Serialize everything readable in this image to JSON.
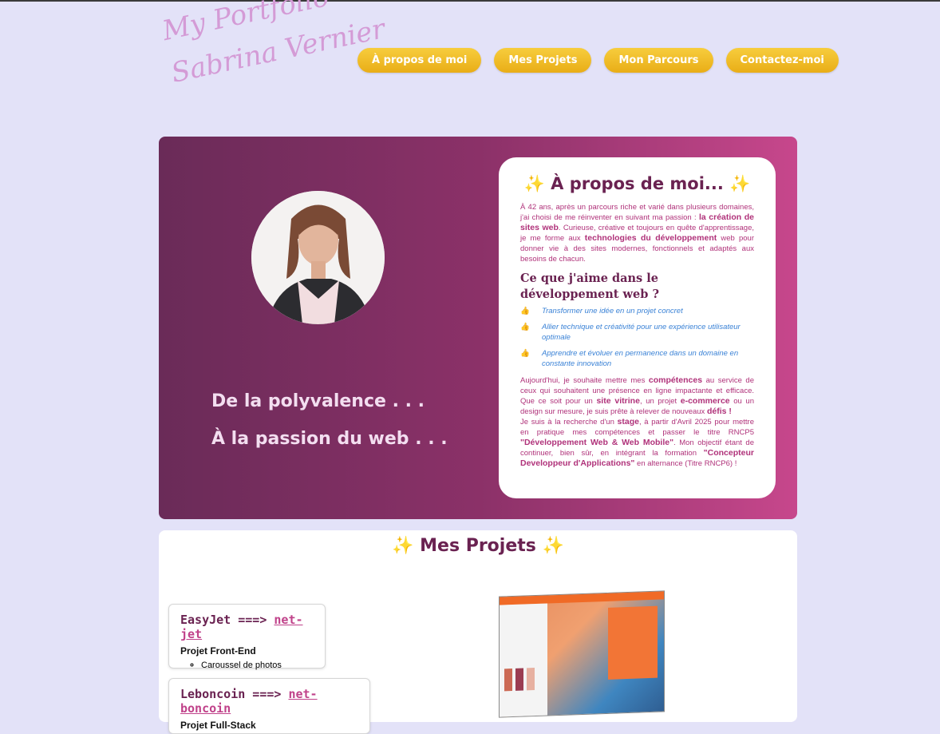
{
  "logo": {
    "line1": "My Portfolio",
    "line2": "Sabrina Vernier"
  },
  "nav": [
    {
      "label": "À propos de moi"
    },
    {
      "label": "Mes Projets"
    },
    {
      "label": "Mon Parcours"
    },
    {
      "label": "Contactez-moi"
    }
  ],
  "hero": {
    "tagline1": "De la polyvalence . . .",
    "tagline2": "À la passion du web . . ."
  },
  "about": {
    "spark": "✨",
    "title": "À propos de moi...",
    "p1_a": "À 42 ans, après un parcours riche et varié dans plusieurs domaines, j'ai choisi de me réinventer en suivant ma passion : ",
    "p1_b": "la création de sites web",
    "p1_c": ". Curieuse, créative et toujours en quête d'apprentissage, je me forme aux ",
    "p1_d": "technologies du développement",
    "p1_e": " web pour donner vie à des sites modernes, fonctionnels et adaptés aux besoins de chacun.",
    "subtitle": "Ce que j'aime dans le développement web ?",
    "thumb": "👍",
    "likes": [
      "Transformer une idée en un projet concret",
      "Allier technique et créativité pour une expérience utilisateur optimale",
      "Apprendre et évoluer en permanence dans un domaine en constante innovation"
    ],
    "p2_a": "Aujourd'hui, je souhaite mettre mes ",
    "p2_b": "compétences",
    "p2_c": " au service de ceux qui souhaitent une présence en ligne impactante et efficace. Que ce soit pour un ",
    "p2_d": "site vitrine",
    "p2_e": ", un projet ",
    "p2_f": "e-commerce",
    "p2_g": " ou un design sur mesure, je suis prête à relever de nouveaux ",
    "p2_h": "défis !",
    "p3_a": "Je suis à la recherche d'un ",
    "p3_b": "stage",
    "p3_c": ", à partir d'Avril 2025 pour mettre en pratique mes compétences et passer le titre RNCP5 ",
    "p3_d": "\"Développement Web & Web Mobile\"",
    "p3_e": ". Mon objectif étant de continuer, bien sûr, en intégrant la formation ",
    "p3_f": "\"Concepteur Developpeur d'Applications\"",
    "p3_g": " en alternance (Titre RNCP6) !"
  },
  "projects": {
    "title": "Mes Projets",
    "items": [
      {
        "name": "EasyJet ===> ",
        "link": "net-jet",
        "type": "Projet Front-End",
        "features": [
          "Caroussel de photos"
        ]
      },
      {
        "name": "Leboncoin ===> ",
        "link": "net-boncoin",
        "type": "Projet Full-Stack",
        "features": []
      }
    ]
  }
}
